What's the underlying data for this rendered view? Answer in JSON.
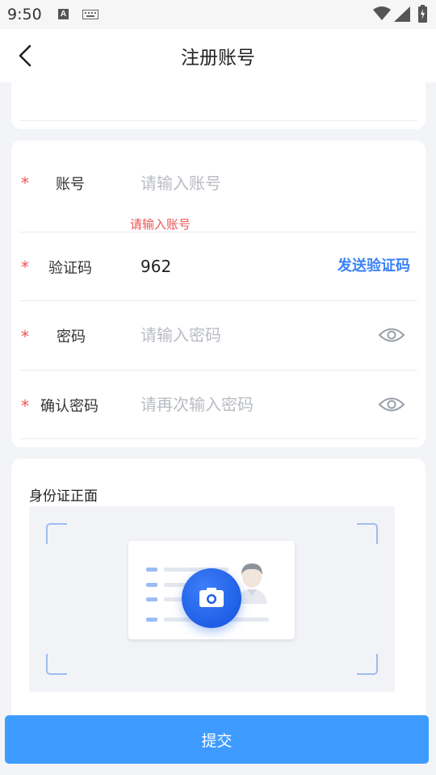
{
  "status_bar": {
    "time": "9:50",
    "a_icon_text": "A"
  },
  "header": {
    "title": "注册账号",
    "back_icon": "chevron-left-icon"
  },
  "form": {
    "required_mark": "*",
    "account": {
      "label": "账号",
      "placeholder": "请输入账号",
      "value": "",
      "error": "请输入账号"
    },
    "code": {
      "label": "验证码",
      "placeholder": "",
      "value": "962",
      "send_label": "发送验证码"
    },
    "password": {
      "label": "密码",
      "placeholder": "请输入密码",
      "value": ""
    },
    "confirm": {
      "label": "确认密码",
      "placeholder": "请再次输入密码",
      "value": ""
    }
  },
  "upload": {
    "title": "身份证正面",
    "icon": "camera-icon"
  },
  "submit": {
    "label": "提交"
  },
  "colors": {
    "accent": "#3d9bff",
    "link": "#3b82f6",
    "error": "#f05454",
    "camera": "#1f5fe6"
  }
}
